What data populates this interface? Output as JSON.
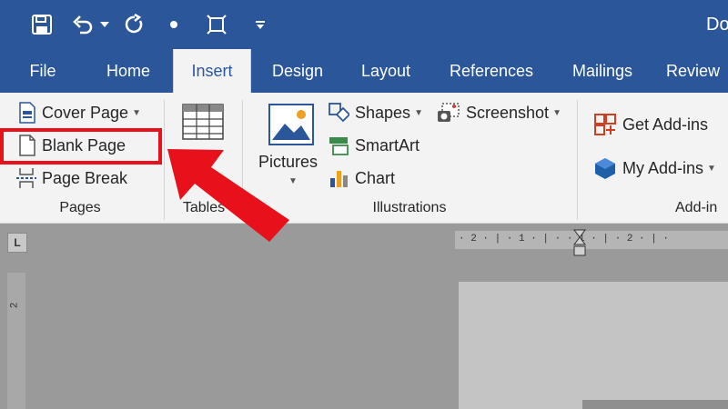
{
  "title_bar": {
    "doc_title": "Do",
    "quick_access": [
      "save-icon",
      "undo-icon",
      "redo-icon",
      "touch-mode-icon",
      "select-icon",
      "customize-icon"
    ]
  },
  "tabs": [
    {
      "label": "File",
      "active": false
    },
    {
      "label": "Home",
      "active": false
    },
    {
      "label": "Insert",
      "active": true
    },
    {
      "label": "Design",
      "active": false
    },
    {
      "label": "Layout",
      "active": false
    },
    {
      "label": "References",
      "active": false
    },
    {
      "label": "Mailings",
      "active": false
    },
    {
      "label": "Review",
      "active": false
    }
  ],
  "ribbon": {
    "pages": {
      "label": "Pages",
      "items": [
        "Cover Page",
        "Blank Page",
        "Page Break"
      ]
    },
    "tables": {
      "label": "Tables"
    },
    "illustrations": {
      "label": "Illustrations",
      "pictures": "Pictures",
      "shapes": "Shapes",
      "smartart": "SmartArt",
      "chart": "Chart",
      "screenshot": "Screenshot"
    },
    "addins": {
      "label": "Add-in",
      "get": "Get Add-ins",
      "my": "My Add-ins"
    }
  },
  "rulers": {
    "corner": "L",
    "horizontal": "· 2 · | · 1 · | ·  · 1 · | · 2 · | ·",
    "vertical_mark": "2"
  },
  "colors": {
    "brand": "#2b579a",
    "highlight": "#e8101a",
    "ribbon": "#f3f3f3"
  }
}
